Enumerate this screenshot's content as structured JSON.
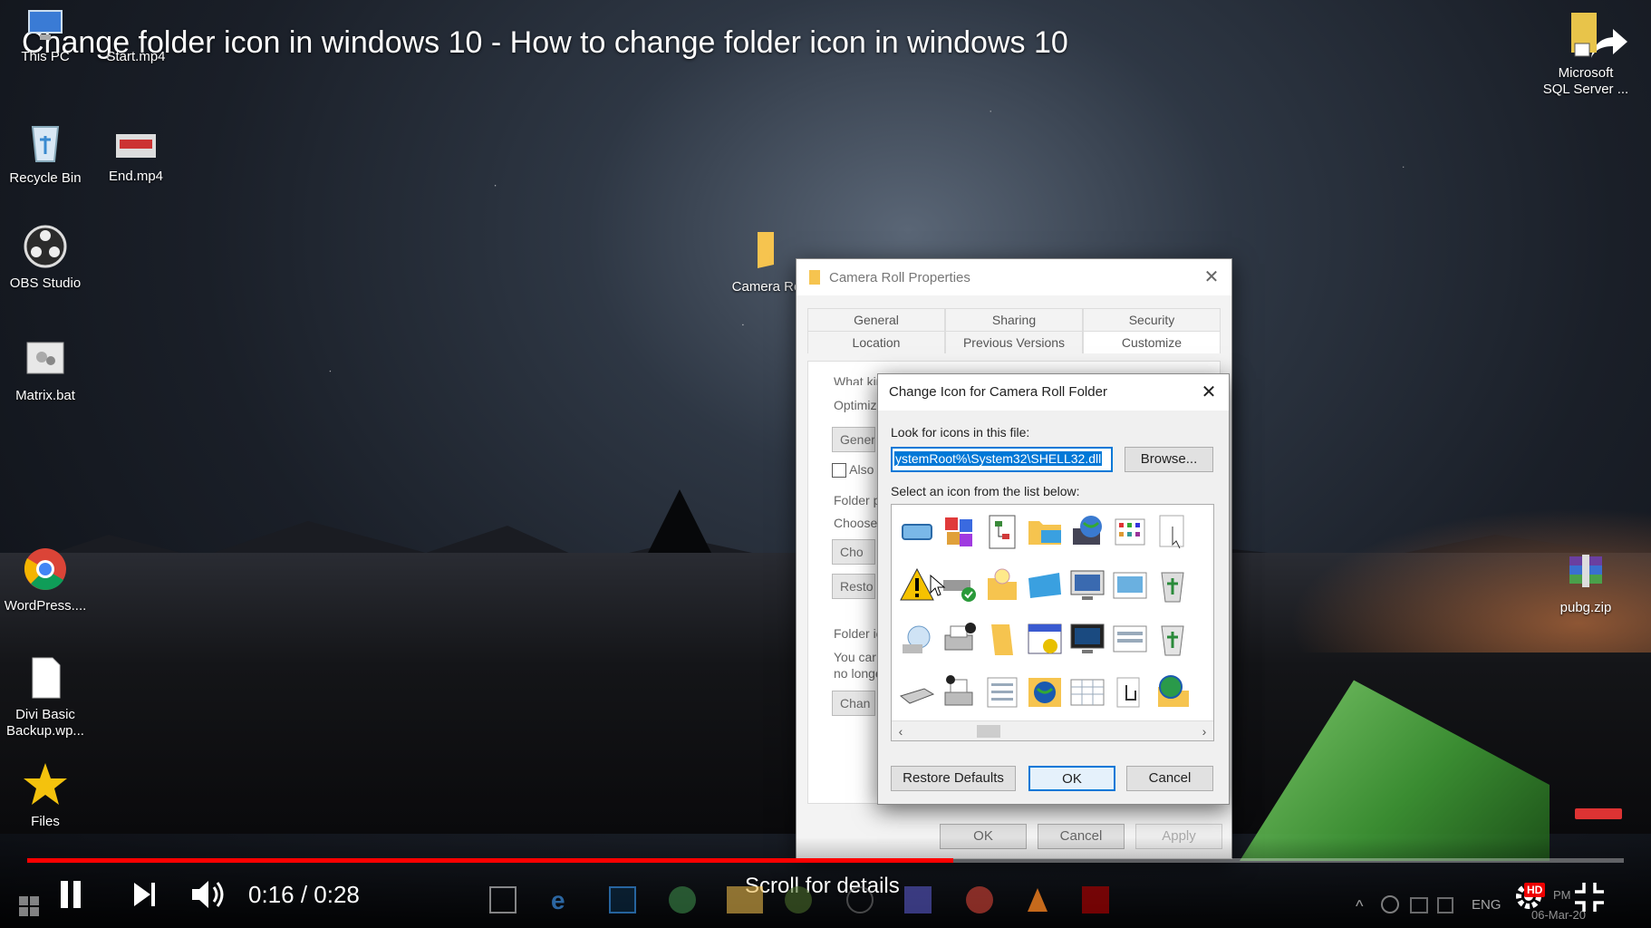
{
  "video": {
    "title": "Change folder icon in windows 10 - How to change folder icon in windows 10",
    "time": "0:16 / 0:28",
    "progress": 0.58,
    "scroll_hint": "Scroll for details",
    "hd_badge": "HD",
    "accent": "#ff0000"
  },
  "desktop": {
    "icons": {
      "this_pc": "This PC",
      "start_mp4": "Start.mp4",
      "recycle_bin": "Recycle Bin",
      "end_mp4": "End.mp4",
      "obs": "OBS Studio",
      "matrix": "Matrix.bat",
      "wordpress": "WordPress....",
      "divi_1": "Divi Basic",
      "divi_2": "Backup.wp...",
      "files": "Files",
      "camera_roll": "Camera Ro",
      "sql_1": "Microsoft",
      "sql_2": "SQL Server ...",
      "pubg": "pubg.zip"
    }
  },
  "props": {
    "title": "Camera Roll Properties",
    "tabs_top": [
      "General",
      "Sharing",
      "Security"
    ],
    "tabs_bottom": [
      "Location",
      "Previous Versions",
      "Customize"
    ],
    "frag_question": "What kind of folder do you want?",
    "frag_optimize": "Optimize",
    "frag_general": "Genera",
    "frag_also": "Also",
    "frag_folder_p": "Folder p",
    "frag_choose": "Choose",
    "frag_cho_btn": "Cho",
    "frag_resto_btn": "Resto",
    "frag_folder_i": "Folder ic",
    "frag_you_can": "You car",
    "frag_no_longer": "no longe",
    "frag_chan_btn": "Chan",
    "ok": "OK",
    "cancel": "Cancel",
    "apply": "Apply"
  },
  "dialog": {
    "title": "Change Icon for Camera Roll Folder",
    "look_label": "Look for icons in this file:",
    "path_value": "ystemRoot%\\System32\\SHELL32.dll",
    "browse": "Browse...",
    "select_label": "Select an icon from the list below:",
    "restore": "Restore Defaults",
    "ok": "OK",
    "cancel": "Cancel",
    "icons": [
      "drive-icon",
      "colorful-tiles-icon",
      "network-diagram-icon",
      "folder-network-icon",
      "globe-computer-icon",
      "icon-grid-icon",
      "cursor-document-icon",
      "key-icon",
      "warning-icon",
      "drive-check-icon",
      "lightbulb-folder-icon",
      "monitor-blue-icon",
      "computer-screen-icon",
      "slideshow-icon",
      "recycle-full-icon",
      "partial-icon",
      "network-globe-icon",
      "printer-check-icon",
      "folder-yellow-icon",
      "calendar-icon",
      "monitor-dark-icon",
      "window-list-icon",
      "recycle-icon",
      "partial-icon",
      "drive-flat-icon",
      "printer-stack-icon",
      "document-list-icon",
      "globe-photo-icon",
      "details-grid-icon",
      "hand-cursor-icon",
      "globe-folder-icon",
      "partial-icon"
    ]
  },
  "taskbar": {
    "language": "ENG",
    "clock_time": "PM",
    "clock_date": "06-Mar-20"
  }
}
